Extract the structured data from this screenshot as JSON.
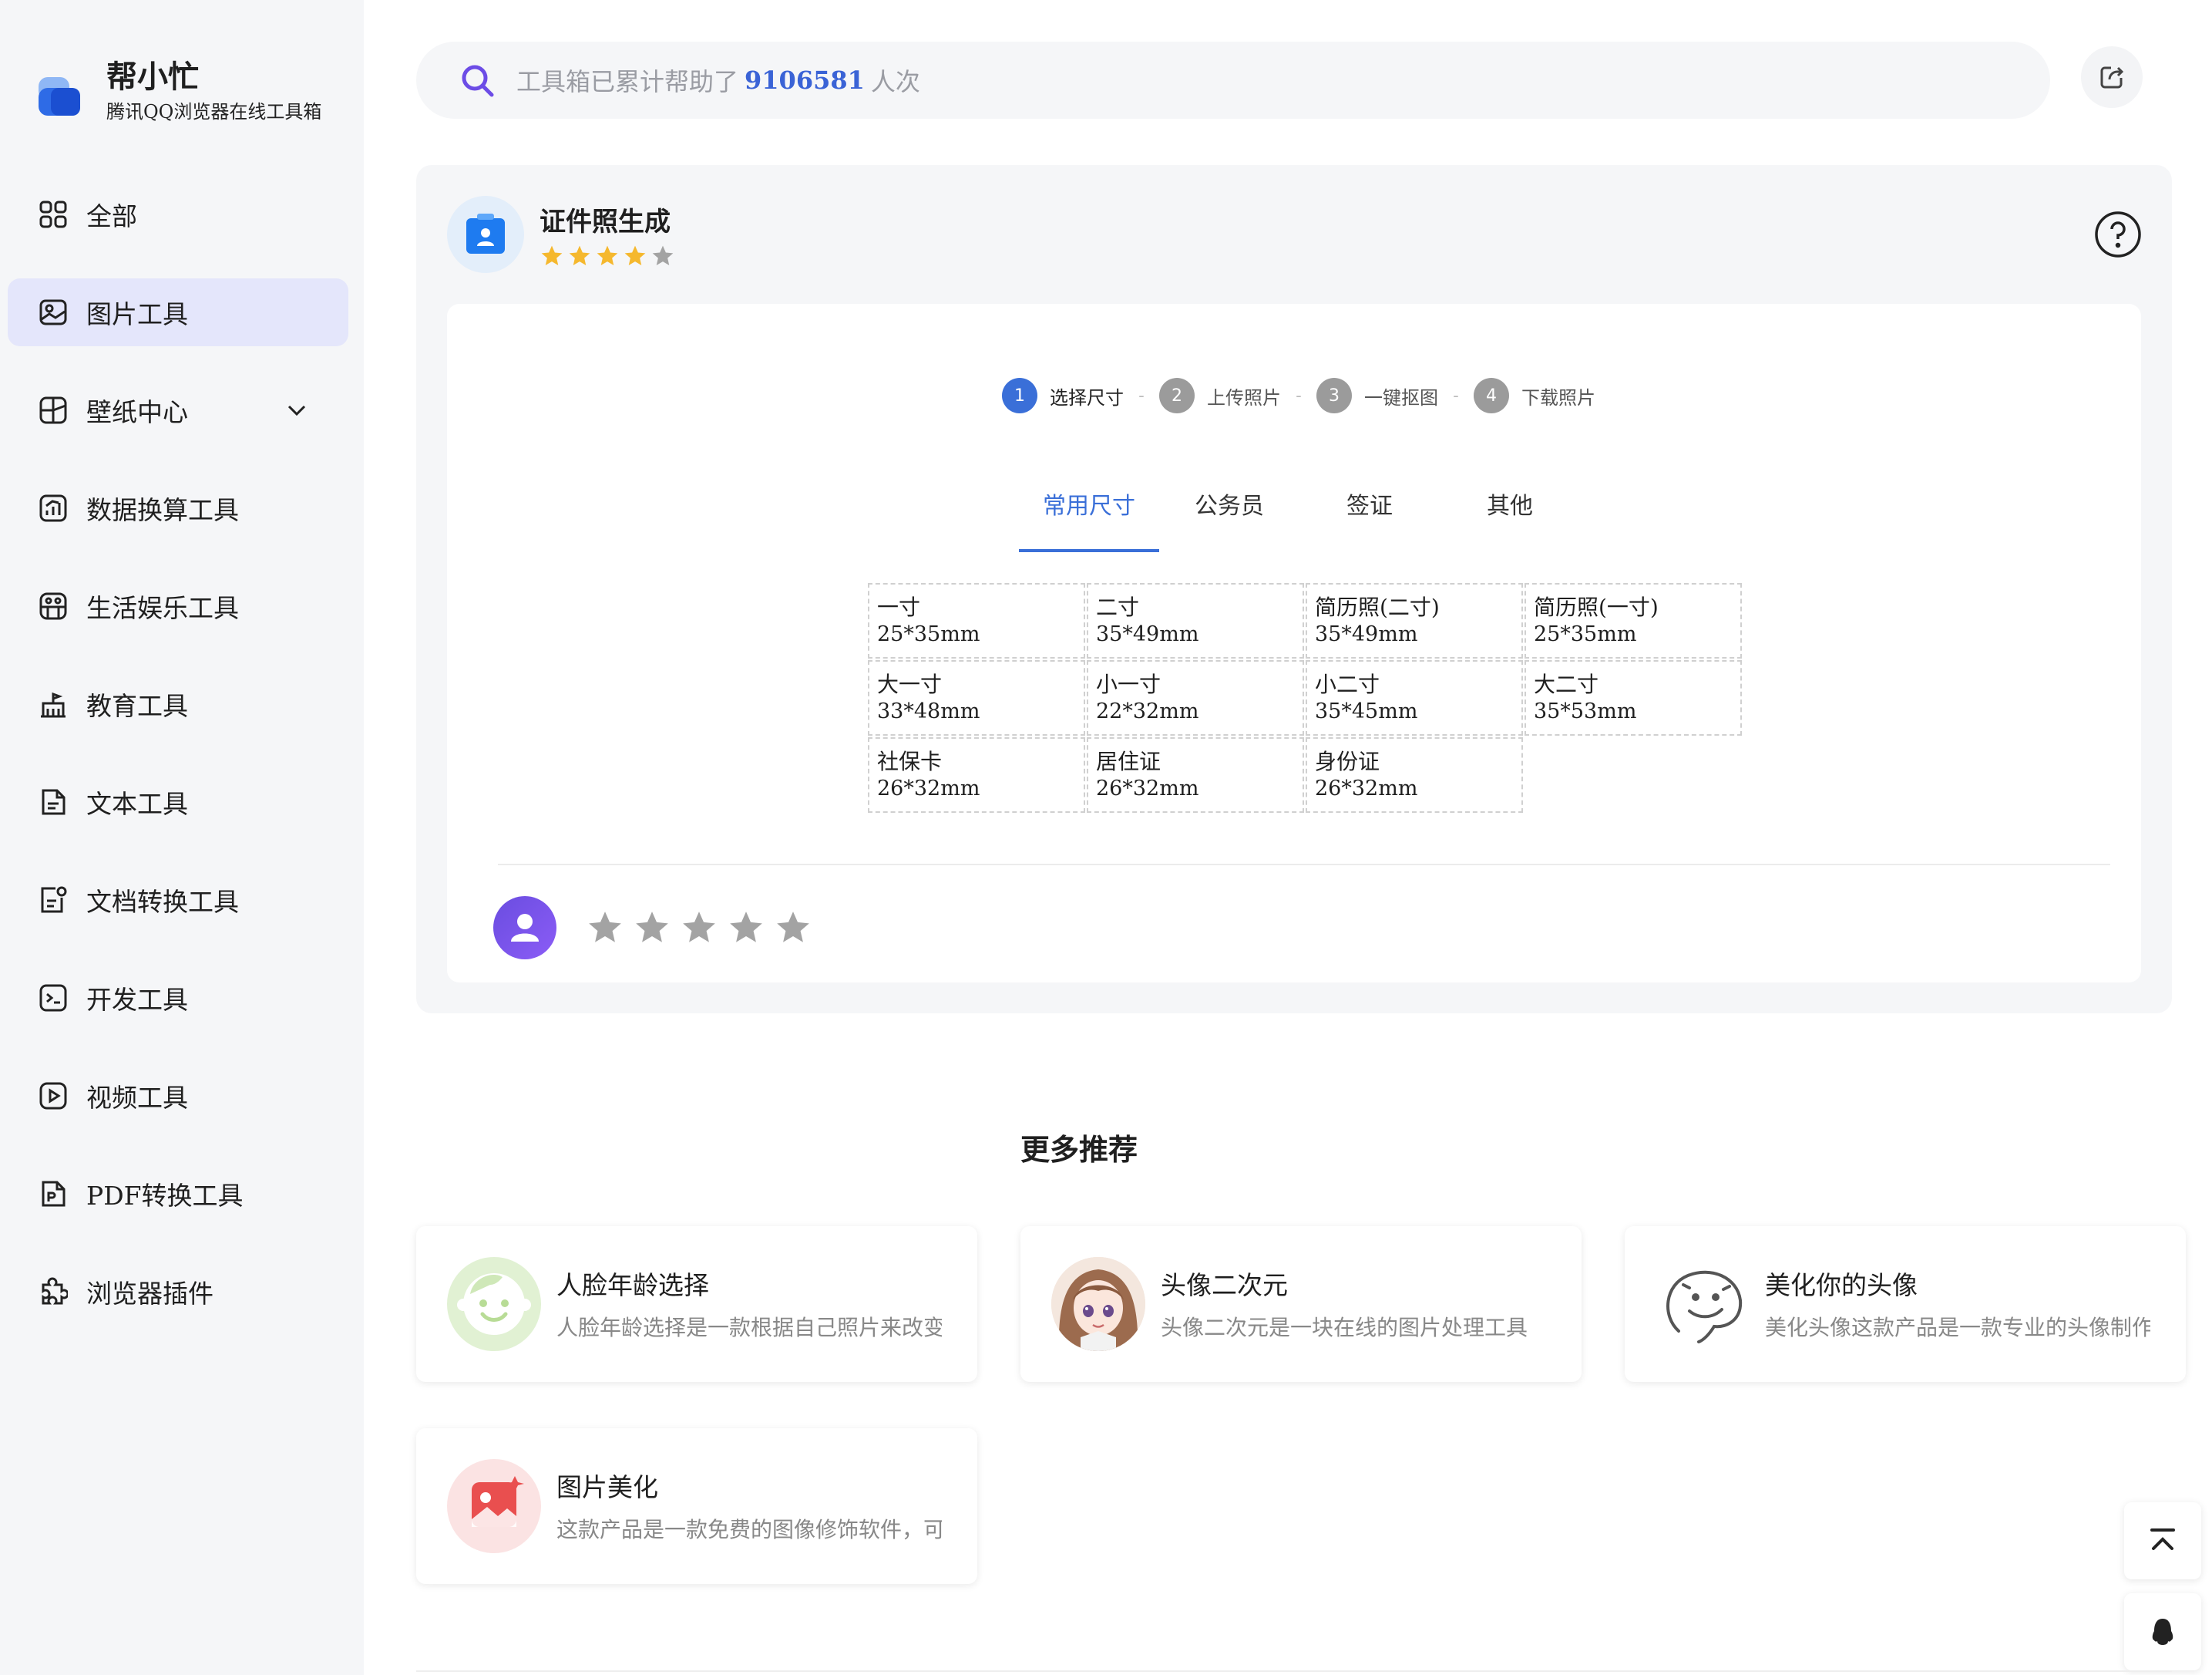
{
  "brand": {
    "name": "帮小忙",
    "subtitle": "腾讯QQ浏览器在线工具箱"
  },
  "sidebar": {
    "items": [
      {
        "label": "全部",
        "icon": "grid-icon"
      },
      {
        "label": "图片工具",
        "icon": "image-icon",
        "active": true
      },
      {
        "label": "壁纸中心",
        "icon": "wallpaper-icon",
        "expandable": true
      },
      {
        "label": "数据换算工具",
        "icon": "chart-icon"
      },
      {
        "label": "生活娱乐工具",
        "icon": "entertainment-icon"
      },
      {
        "label": "教育工具",
        "icon": "school-icon"
      },
      {
        "label": "文本工具",
        "icon": "document-icon"
      },
      {
        "label": "文档转换工具",
        "icon": "doc-convert-icon"
      },
      {
        "label": "开发工具",
        "icon": "terminal-icon"
      },
      {
        "label": "视频工具",
        "icon": "play-icon"
      },
      {
        "label": "PDF转换工具",
        "icon": "pdf-icon"
      },
      {
        "label": "浏览器插件",
        "icon": "puzzle-icon"
      }
    ]
  },
  "search": {
    "prefix": "工具箱已累计帮助了",
    "count": "9106581",
    "suffix": "人次"
  },
  "tool": {
    "title": "证件照生成",
    "rating_filled": 4,
    "rating_total": 5,
    "steps": [
      {
        "num": "1",
        "label": "选择尺寸",
        "active": true
      },
      {
        "num": "2",
        "label": "上传照片"
      },
      {
        "num": "3",
        "label": "一键抠图"
      },
      {
        "num": "4",
        "label": "下载照片"
      }
    ],
    "step_separator": "-",
    "tabs": [
      {
        "label": "常用尺寸",
        "active": true
      },
      {
        "label": "公务员"
      },
      {
        "label": "签证"
      },
      {
        "label": "其他"
      }
    ],
    "sizes": [
      {
        "name": "一寸",
        "size": "25*35mm"
      },
      {
        "name": "二寸",
        "size": "35*49mm"
      },
      {
        "name": "简历照(二寸)",
        "size": "35*49mm"
      },
      {
        "name": "简历照(一寸)",
        "size": "25*35mm"
      },
      {
        "name": "大一寸",
        "size": "33*48mm"
      },
      {
        "name": "小一寸",
        "size": "22*32mm"
      },
      {
        "name": "小二寸",
        "size": "35*45mm"
      },
      {
        "name": "大二寸",
        "size": "35*53mm"
      },
      {
        "name": "社保卡",
        "size": "26*32mm"
      },
      {
        "name": "居住证",
        "size": "26*32mm"
      },
      {
        "name": "身份证",
        "size": "26*32mm"
      }
    ],
    "user_rating_filled": 0,
    "user_rating_total": 5
  },
  "more": {
    "title": "更多推荐",
    "items": [
      {
        "title": "人脸年龄选择",
        "desc": "人脸年龄选择是一款根据自己照片来改变年龄的工具",
        "icon": "baby-face-icon"
      },
      {
        "title": "头像二次元",
        "desc": "头像二次元是一块在线的图片处理工具",
        "icon": "anime-avatar-icon"
      },
      {
        "title": "美化你的头像",
        "desc": "美化头像这款产品是一款专业的头像制作工具",
        "icon": "smiley-sketch-icon"
      },
      {
        "title": "图片美化",
        "desc": "这款产品是一款免费的图像修饰软件，可以美化图片",
        "icon": "photo-edit-icon"
      }
    ]
  },
  "colors": {
    "accent": "#3a6fd8",
    "star": "#f5b82e",
    "star_empty": "#a3a3a3",
    "active_nav": "#e4e6fb"
  }
}
